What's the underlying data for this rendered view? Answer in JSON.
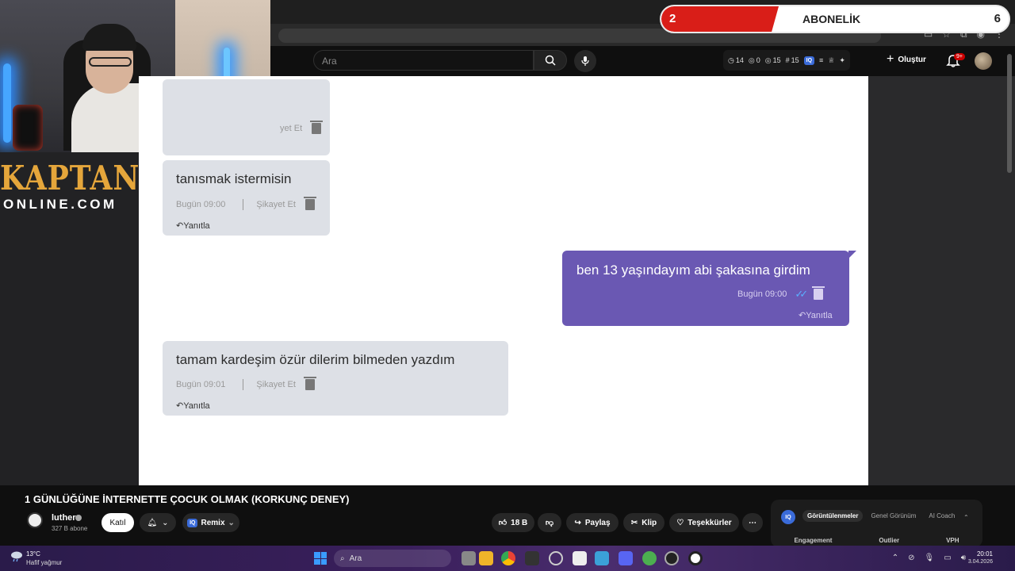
{
  "overlay": {
    "left_value": "2",
    "label": "ABONELİK",
    "right_value": "6"
  },
  "logo": {
    "top": "KAPTAN",
    "bottom": "ONLINE.COM"
  },
  "header": {
    "search_placeholder": "Ara",
    "stats": [
      "14",
      "0",
      "15",
      "15"
    ],
    "iq_label": "IQ",
    "create_label": "Oluştur",
    "notif_count": "9+"
  },
  "chat": {
    "messages": [
      {
        "text": "",
        "time": "",
        "report": "yet Et",
        "reply": ""
      },
      {
        "text": "tanısmak istermisin",
        "time": "Bugün 09:00",
        "report": "Şikayet Et",
        "reply": "Yanıtla"
      },
      {
        "text": "ben 13 yaşındayım abi şakasına girdim",
        "time": "Bugün 09:00",
        "report": "",
        "reply": "Yanıtla"
      },
      {
        "text": "tamam kardeşim özür dilerim bilmeden yazdım",
        "time": "Bugün 09:01",
        "report": "Şikayet Et",
        "reply": "Yanıtla"
      }
    ]
  },
  "video": {
    "title": "1 GÜNLÜĞÜNE İNTERNETTE ÇOCUK OLMAK (KORKUNÇ DENEY)",
    "channel_name": "luther",
    "subscribers": "327 B abone",
    "join_label": "Katıl",
    "remix_label": "Remix",
    "likes": "18 B",
    "share_label": "Paylaş",
    "clip_label": "Klip",
    "thanks_label": "Teşekkürler"
  },
  "analytics": {
    "iq_label": "IQ",
    "tabs": [
      "Görüntülenmeler",
      "Genel Görünüm",
      "AI Coach"
    ],
    "columns": [
      "Engagement",
      "Outlier",
      "VPH"
    ]
  },
  "taskbar": {
    "weather_temp": "13°C",
    "weather_desc": "Hafif yağmur",
    "search_label": "Ara",
    "time": "20:01",
    "date": "3.04.2026"
  },
  "colors": {
    "outgoing_bubble": "#6a58b3",
    "incoming_bubble": "#dde0e6",
    "logo_gold": "#e5a63b",
    "overlay_red": "#d91e18"
  }
}
